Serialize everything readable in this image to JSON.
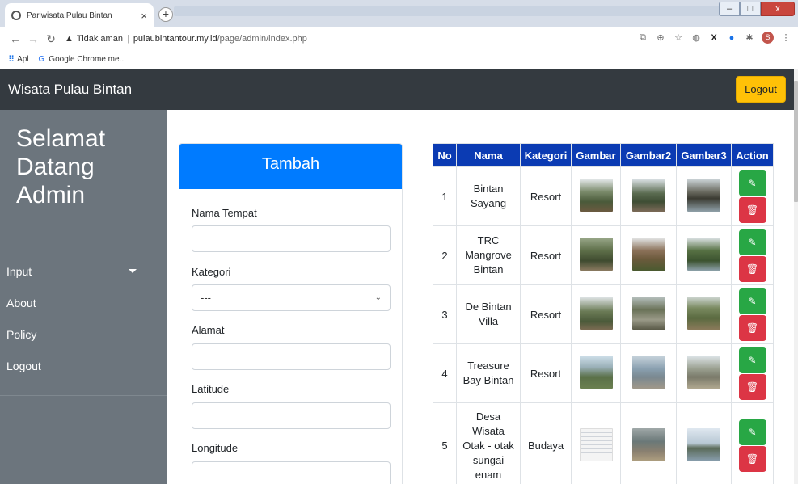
{
  "browser": {
    "tab_title": "Pariwisata Pulau Bintan",
    "tab_close": "×",
    "new_tab": "+",
    "security_label": "Tidak aman",
    "url_host": "pulaubintantour.my.id",
    "url_path": "/page/admin/index.php",
    "bookmarks": [
      "Apl",
      "Google Chrome me..."
    ],
    "profile_initial": "S",
    "window_controls": [
      "–",
      "□",
      "x"
    ]
  },
  "navbar": {
    "brand": "Wisata Pulau Bintan",
    "logout_label": "Logout"
  },
  "sidebar": {
    "welcome_lines": [
      "Selamat",
      "Datang",
      "Admin"
    ],
    "items": [
      {
        "label": "Input",
        "has_caret": true
      },
      {
        "label": "About"
      },
      {
        "label": "Policy"
      },
      {
        "label": "Logout"
      }
    ]
  },
  "form": {
    "title": "Tambah",
    "nama_label": "Nama Tempat",
    "kategori_label": "Kategori",
    "kategori_value": "---",
    "alamat_label": "Alamat",
    "latitude_label": "Latitude",
    "longitude_label": "Longitude"
  },
  "table": {
    "headers": [
      "No",
      "Nama",
      "Kategori",
      "Gambar",
      "Gambar2",
      "Gambar3",
      "Action"
    ],
    "rows": [
      {
        "no": "1",
        "nama": [
          "Bintan",
          "Sayang"
        ],
        "kategori": "Resort"
      },
      {
        "no": "2",
        "nama": [
          "TRC",
          "Mangrove",
          "Bintan"
        ],
        "kategori": "Resort"
      },
      {
        "no": "3",
        "nama": [
          "De Bintan",
          "Villa"
        ],
        "kategori": "Resort"
      },
      {
        "no": "4",
        "nama": [
          "Treasure",
          "Bay Bintan"
        ],
        "kategori": "Resort"
      },
      {
        "no": "5",
        "nama": [
          "Desa",
          "Wisata",
          "Otak - otak",
          "sungai",
          "enam"
        ],
        "kategori": "Budaya"
      }
    ]
  },
  "colors": {
    "navbar": "#343a40",
    "sidebar": "#6c757d",
    "primary": "#007bff",
    "table_header": "#0b3bb3",
    "warning": "#ffc107",
    "success": "#28a745",
    "danger": "#dc3545"
  },
  "icons": {
    "edit": "pencil-icon",
    "delete": "trash-icon"
  }
}
